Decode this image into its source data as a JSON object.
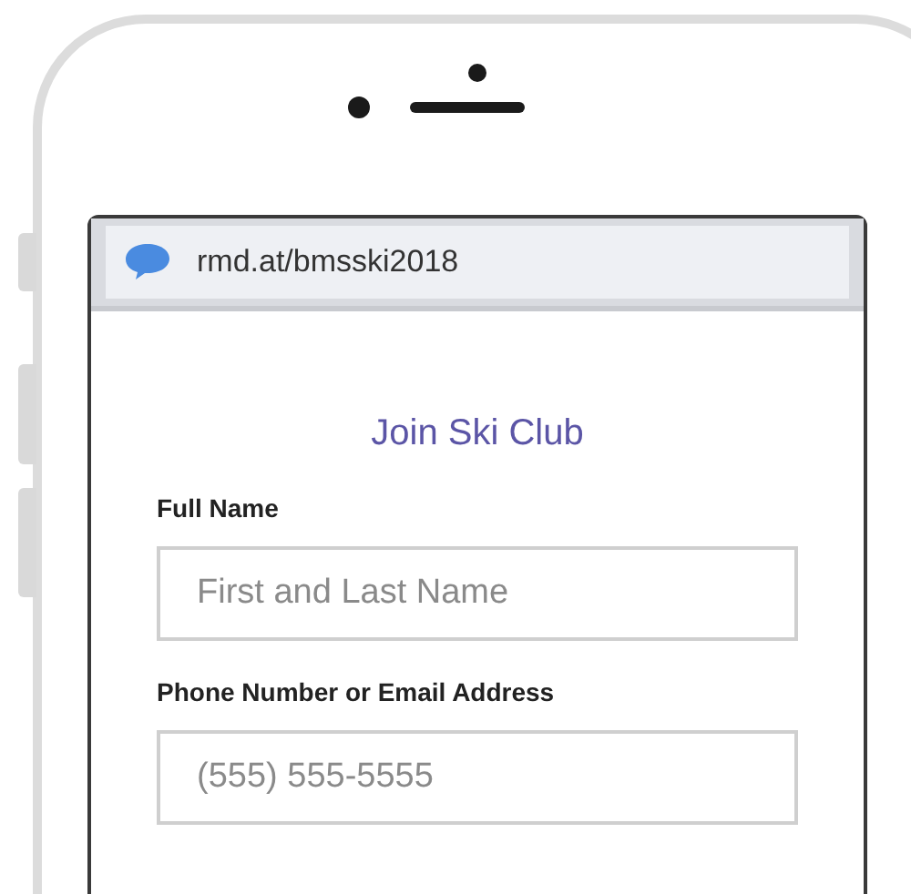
{
  "address_bar": {
    "url": "rmd.at/bmsski2018"
  },
  "form": {
    "title": "Join Ski Club",
    "fields": [
      {
        "label": "Full Name",
        "placeholder": "First and Last Name"
      },
      {
        "label": "Phone Number or Email Address",
        "placeholder": "(555) 555-5555"
      }
    ]
  }
}
